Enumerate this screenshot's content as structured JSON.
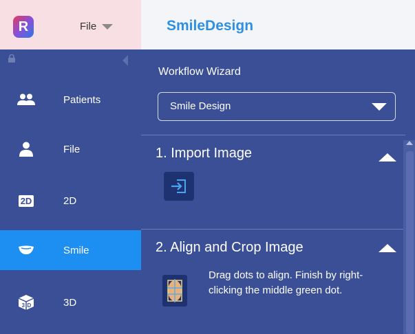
{
  "header": {
    "logo_letter": "R",
    "file_menu_label": "File",
    "app_title": "SmileDesign"
  },
  "sidebar": {
    "items": [
      {
        "label": "Patients",
        "icon": "patients-icon",
        "active": false
      },
      {
        "label": "File",
        "icon": "person-icon",
        "active": false
      },
      {
        "label": "2D",
        "icon": "2d-icon",
        "icon_text": "2D",
        "active": false
      },
      {
        "label": "Smile",
        "icon": "smile-icon",
        "active": true
      },
      {
        "label": "3D",
        "icon": "3d-cube-icon",
        "active": false
      }
    ]
  },
  "main": {
    "workflow_title": "Workflow Wizard",
    "workflow_select_value": "Smile Design",
    "sections": [
      {
        "title": "1. Import Image"
      },
      {
        "title": "2. Align and Crop Image",
        "description": "Drag dots to align. Finish by right-clicking the middle green dot."
      }
    ]
  },
  "colors": {
    "panel": "#3a4f95",
    "active": "#1d8ff2",
    "title_blue": "#2f8fe0",
    "logo_bg": "#f7dfe4"
  }
}
